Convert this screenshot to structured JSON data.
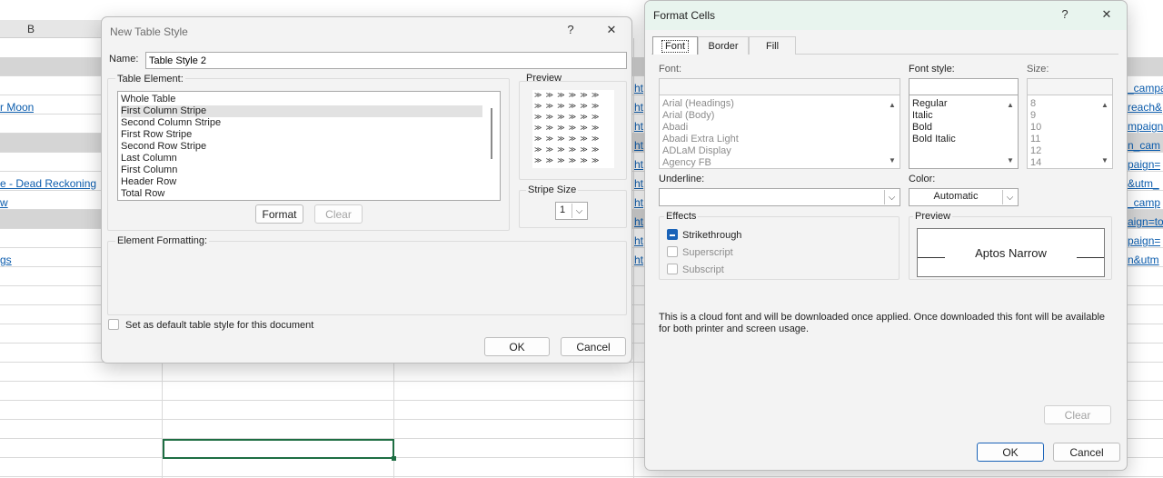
{
  "sheet": {
    "col_b_header": "B",
    "left_links": [
      "r Moon",
      "e - Dead Reckoning",
      "w",
      "gs"
    ],
    "right_links": [
      {
        "prefix": "ht",
        "suffix": "_campa"
      },
      {
        "prefix": "ht",
        "suffix": "reach&"
      },
      {
        "prefix": "ht",
        "suffix": "mpaign"
      },
      {
        "prefix": "ht",
        "suffix": "n_cam"
      },
      {
        "prefix": "ht",
        "suffix": "paign="
      },
      {
        "prefix": "ht",
        "suffix": "&utm_"
      },
      {
        "prefix": "ht",
        "suffix": "_camp"
      },
      {
        "prefix": "ht",
        "suffix": "aign=to"
      },
      {
        "prefix": "ht",
        "suffix": "paign="
      },
      {
        "prefix": "ht",
        "suffix": "n&utm"
      }
    ]
  },
  "new_table_style": {
    "title": "New Table Style",
    "help_glyph": "?",
    "close_glyph": "✕",
    "name_label": "Name:",
    "name_value": "Table Style 2",
    "table_element_label": "Table Element:",
    "elements": [
      "Whole Table",
      "First Column Stripe",
      "Second Column Stripe",
      "First Row Stripe",
      "Second Row Stripe",
      "Last Column",
      "First Column",
      "Header Row",
      "Total Row"
    ],
    "preview_label": "Preview",
    "preview_rows": [
      "≫ ≫ ≫ ≫ ≫ ≫",
      "≫ ≫ ≫ ≫ ≫ ≫",
      "≫ ≫ ≫ ≫ ≫ ≫",
      "≫ ≫ ≫ ≫ ≫ ≫",
      "≫ ≫ ≫ ≫ ≫ ≫",
      "≫ ≫ ≫ ≫ ≫ ≫",
      "≫ ≫ ≫ ≫ ≫ ≫"
    ],
    "format_button": "Format",
    "clear_button": "Clear",
    "stripe_size_label": "Stripe Size",
    "stripe_size_value": "1",
    "element_formatting_label": "Element Formatting:",
    "default_checkbox_label": "Set as default table style for this document",
    "ok_button": "OK",
    "cancel_button": "Cancel"
  },
  "format_cells": {
    "title": "Format Cells",
    "help_glyph": "?",
    "close_glyph": "✕",
    "tabs": [
      "Font",
      "Border",
      "Fill"
    ],
    "font_label": "Font:",
    "font_style_label": "Font style:",
    "size_label": "Size:",
    "fonts": [
      "Arial (Headings)",
      "Arial (Body)",
      "Abadi",
      "Abadi Extra Light",
      "ADLaM Display",
      "Agency FB"
    ],
    "font_styles": [
      "Regular",
      "Italic",
      "Bold",
      "Bold Italic"
    ],
    "sizes": [
      "8",
      "9",
      "10",
      "11",
      "12",
      "14"
    ],
    "underline_label": "Underline:",
    "color_label": "Color:",
    "color_value": "Automatic",
    "effects_label": "Effects",
    "strikethrough_label": "Strikethrough",
    "superscript_label": "Superscript",
    "subscript_label": "Subscript",
    "preview_label": "Preview",
    "preview_text": "Aptos Narrow",
    "cloud_note": "This is a cloud font and will be downloaded once applied. Once downloaded this font will be available for both printer and screen usage.",
    "clear_button": "Clear",
    "ok_button": "OK",
    "cancel_button": "Cancel"
  }
}
